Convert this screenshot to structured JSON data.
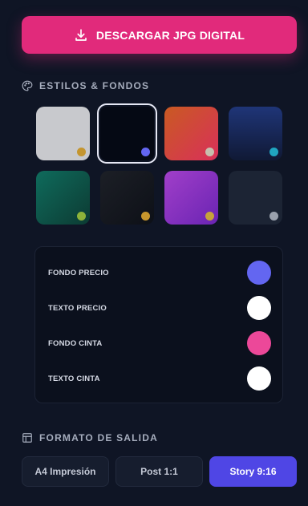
{
  "download_button": {
    "label": "DESCARGAR JPG DIGITAL",
    "icon": "download-icon"
  },
  "styles_section": {
    "title": "ESTILOS & FONDOS",
    "icon": "palette-icon",
    "swatches": [
      {
        "name": "swatch-light-gray",
        "background": "#c8c9cd",
        "dot": "#c4952f",
        "selected": false
      },
      {
        "name": "swatch-midnight",
        "background": "#050914",
        "dot": "#6366f1",
        "selected": true
      },
      {
        "name": "swatch-sunset",
        "background": "linear-gradient(135deg,#c95a22,#d9305a)",
        "dot": "#c7bfae",
        "selected": false
      },
      {
        "name": "swatch-navy",
        "background": "linear-gradient(180deg,#1f3578,#101935)",
        "dot": "#20a5c1",
        "selected": false
      },
      {
        "name": "swatch-emerald",
        "background": "linear-gradient(135deg,#0f6b5c,#0c3b33)",
        "dot": "#8db33a",
        "selected": false
      },
      {
        "name": "swatch-charcoal",
        "background": "linear-gradient(135deg,#1c1f26,#0d1017)",
        "dot": "#c7962d",
        "selected": false
      },
      {
        "name": "swatch-violet",
        "background": "linear-gradient(135deg,#a13fc9,#6a24b3)",
        "dot": "#c6a33a",
        "selected": false
      },
      {
        "name": "swatch-slate",
        "background": "#1c2434",
        "dot": "#9aa1ad",
        "selected": false
      }
    ]
  },
  "colors_card": {
    "rows": [
      {
        "label": "FONDO PRECIO",
        "color": "#6366f1"
      },
      {
        "label": "TEXTO PRECIO",
        "color": "#ffffff"
      },
      {
        "label": "FONDO CINTA",
        "color": "#ec4899"
      },
      {
        "label": "TEXTO CINTA",
        "color": "#ffffff"
      }
    ]
  },
  "output_section": {
    "title": "FORMATO DE SALIDA",
    "icon": "layout-icon",
    "formats": [
      {
        "label": "A4 Impresión",
        "active": false
      },
      {
        "label": "Post 1:1",
        "active": false
      },
      {
        "label": "Story 9:16",
        "active": true
      }
    ]
  }
}
